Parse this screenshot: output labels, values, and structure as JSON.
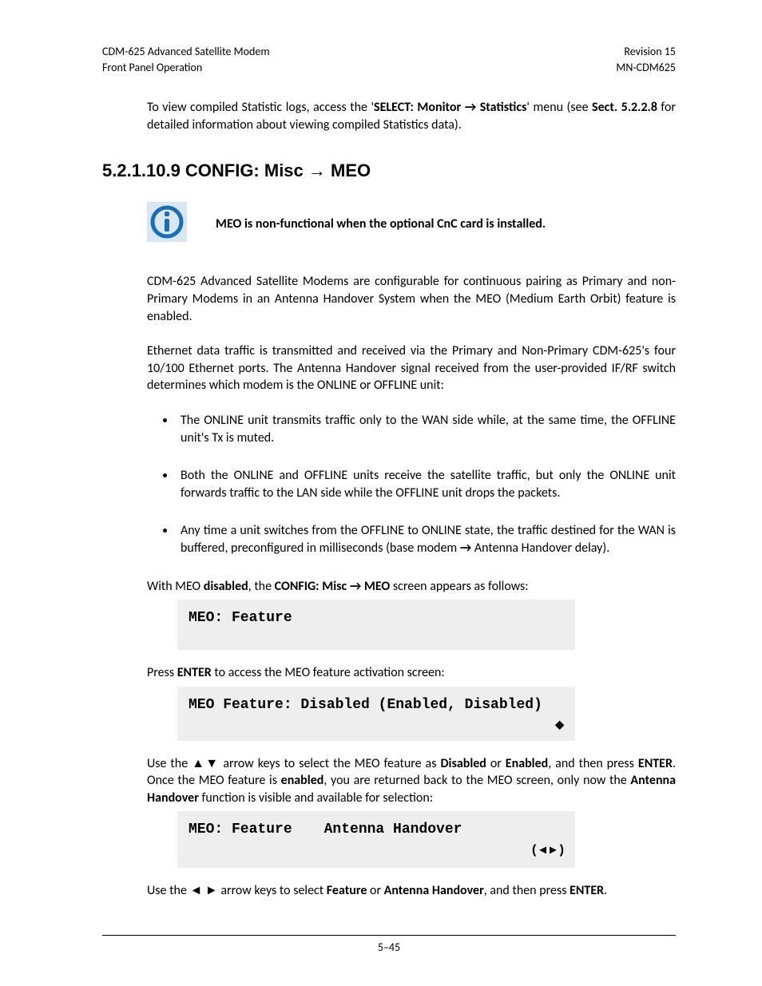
{
  "header": {
    "left1": "CDM-625 Advanced Satellite Modem",
    "left2": "Front Panel Operation",
    "right1": "Revision 15",
    "right2": "MN-CDM625"
  },
  "intro": {
    "p1a": "To view compiled Statistic logs, access the '",
    "p1b": "SELECT: Monitor ",
    "p1c": " Statistics",
    "p1d": "' menu (see ",
    "p1e": "Sect. 5.2.2.8",
    "p1f": " for detailed information about viewing compiled Statistics data)."
  },
  "section": {
    "num": "5.2.1.10.9",
    "title_a": "CONFIG: Misc ",
    "title_b": " MEO"
  },
  "warning": "MEO is non-functional when the optional CnC card is installed.",
  "paras": {
    "p2": "CDM-625 Advanced Satellite Modems are configurable for continuous pairing as Primary and non-Primary Modems in an Antenna Handover System when the MEO (Medium Earth Orbit) feature is enabled.",
    "p3": "Ethernet data traffic is transmitted and received via the Primary and Non-Primary CDM-625's four 10/100 Ethernet ports. The Antenna Handover signal received from the user-provided IF/RF switch determines which modem is the ONLINE or OFFLINE unit:"
  },
  "bullets": {
    "b1": "The ONLINE unit transmits traffic only to the WAN side while, at the same time, the OFFLINE unit's Tx is muted.",
    "b2": "Both the ONLINE and OFFLINE units receive the satellite traffic, but only the ONLINE unit forwards traffic to the LAN side while the OFFLINE unit drops the packets.",
    "b3a": "Any time a unit switches from the OFFLINE to ONLINE state, the traffic destined for the WAN is buffered, preconfigured in milliseconds (base modem ",
    "b3b": " Antenna Handover delay)."
  },
  "after": {
    "p4a": "With MEO ",
    "p4b": "disabled",
    "p4c": ", the ",
    "p4d": "CONFIG: Misc ",
    "p4e": " MEO",
    "p4f": " screen appears as follows:",
    "screen1": "MEO: Feature",
    "p5a": "Press ",
    "p5b": "ENTER",
    "p5c": " to access the MEO feature activation screen:",
    "screen2": "MEO Feature: Disabled (Enabled, Disabled)",
    "screen2_sym": "◆",
    "p6a": "Use the ▲▼ arrow keys to select the MEO feature as ",
    "p6b": "Disabled",
    "p6c": " or ",
    "p6d": "Enabled",
    "p6e": ", and then press ",
    "p6f": "ENTER",
    "p6g": ". Once the MEO feature is ",
    "p6h": "enabled",
    "p6i": ", you are returned back to the MEO screen, only now the ",
    "p6j": "Antenna Handover",
    "p6k": " function is visible and available for selection:",
    "screen3a": "MEO: Feature",
    "screen3b": "Antenna Handover",
    "screen3_sym": "( ◂  ▸ )",
    "p7a": "Use the ◄ ► arrow keys to select ",
    "p7b": "Feature",
    "p7c": " or ",
    "p7d": "Antenna Handover",
    "p7e": ", and then press ",
    "p7f": "ENTER",
    "p7g": "."
  },
  "arrow": "→",
  "footer": "5–45"
}
